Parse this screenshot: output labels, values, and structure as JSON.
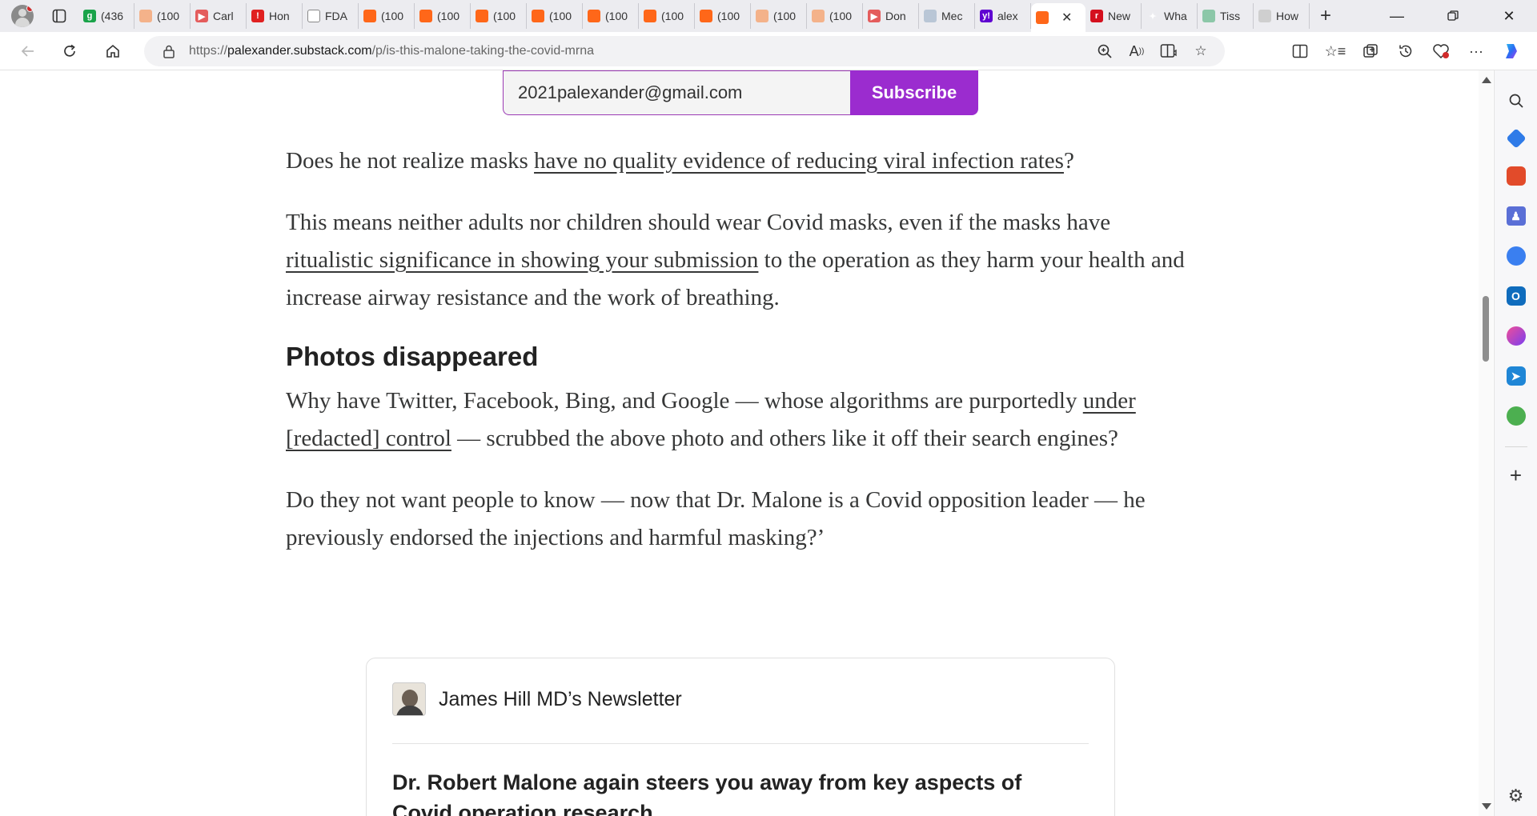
{
  "browser": {
    "tabs": [
      {
        "title": "(436",
        "fav_color": "#1aa34a",
        "fav_glyph": "g"
      },
      {
        "title": "(100",
        "fav_color": "#f4b28a",
        "fav_glyph": ""
      },
      {
        "title": "Carl",
        "fav_color": "#e45c5c",
        "fav_glyph": "▶"
      },
      {
        "title": "Hon",
        "fav_color": "#e02020",
        "fav_glyph": "!"
      },
      {
        "title": "FDA",
        "fav_color": "#ffffff",
        "fav_glyph": ""
      },
      {
        "title": "(100",
        "fav_color": "#ff6719",
        "fav_glyph": ""
      },
      {
        "title": "(100",
        "fav_color": "#ff6719",
        "fav_glyph": ""
      },
      {
        "title": "(100",
        "fav_color": "#ff6719",
        "fav_glyph": ""
      },
      {
        "title": "(100",
        "fav_color": "#ff6719",
        "fav_glyph": ""
      },
      {
        "title": "(100",
        "fav_color": "#ff6719",
        "fav_glyph": ""
      },
      {
        "title": "(100",
        "fav_color": "#ff6719",
        "fav_glyph": ""
      },
      {
        "title": "(100",
        "fav_color": "#ff6719",
        "fav_glyph": ""
      },
      {
        "title": "(100",
        "fav_color": "#f4b28a",
        "fav_glyph": ""
      },
      {
        "title": "(100",
        "fav_color": "#f4b28a",
        "fav_glyph": ""
      },
      {
        "title": "Don",
        "fav_color": "#e45c5c",
        "fav_glyph": "▶"
      },
      {
        "title": "Mec",
        "fav_color": "#b9c6d6",
        "fav_glyph": ""
      },
      {
        "title": "alex",
        "fav_color": "#5f01d1",
        "fav_glyph": "y!"
      },
      {
        "title": "",
        "fav_color": "#ff6719",
        "fav_glyph": "",
        "active": true
      },
      {
        "title": "New",
        "fav_color": "#d4101e",
        "fav_glyph": "r"
      },
      {
        "title": "Wha",
        "fav_color": "#ececf0",
        "fav_glyph": "✦"
      },
      {
        "title": "Tiss",
        "fav_color": "#8cc7a8",
        "fav_glyph": ""
      },
      {
        "title": "How",
        "fav_color": "#cfcfcf",
        "fav_glyph": ""
      }
    ],
    "url": {
      "scheme": "https://",
      "host": "palexander.substack.com",
      "path": "/p/is-this-malone-taking-the-covid-mrna"
    }
  },
  "subscribe": {
    "email": "2021palexander@gmail.com",
    "button_label": "Subscribe"
  },
  "article": {
    "p1": {
      "before": "Does he not realize masks ",
      "link": "have no quality evidence of reducing viral infection rates",
      "after": "?"
    },
    "p2": {
      "before": "This means neither adults nor children should wear Covid masks, even if the masks have ",
      "link": "ritualistic significance in showing your submission",
      "after": " to the operation as they harm your health and increase airway resistance and the work of breathing."
    },
    "heading": "Photos disappeared",
    "p3": {
      "before": "Why have Twitter, Facebook, Bing, and Google — whose algorithms are purportedly ",
      "link": "under [redacted] control",
      "after": " — scrubbed the above photo and others like it off their search engines?"
    },
    "p4": "Do they not want people to know — now that Dr. Malone is a Covid opposition leader — he previously endorsed the injections and harmful masking?’"
  },
  "embed": {
    "publication": "James Hill MD’s Newsletter",
    "post_title": "Dr. Robert Malone again steers you away from key aspects of Covid operation research"
  },
  "colors": {
    "accent": "#9b2ccf",
    "substack_orange": "#ff6719",
    "text": "#363737"
  }
}
